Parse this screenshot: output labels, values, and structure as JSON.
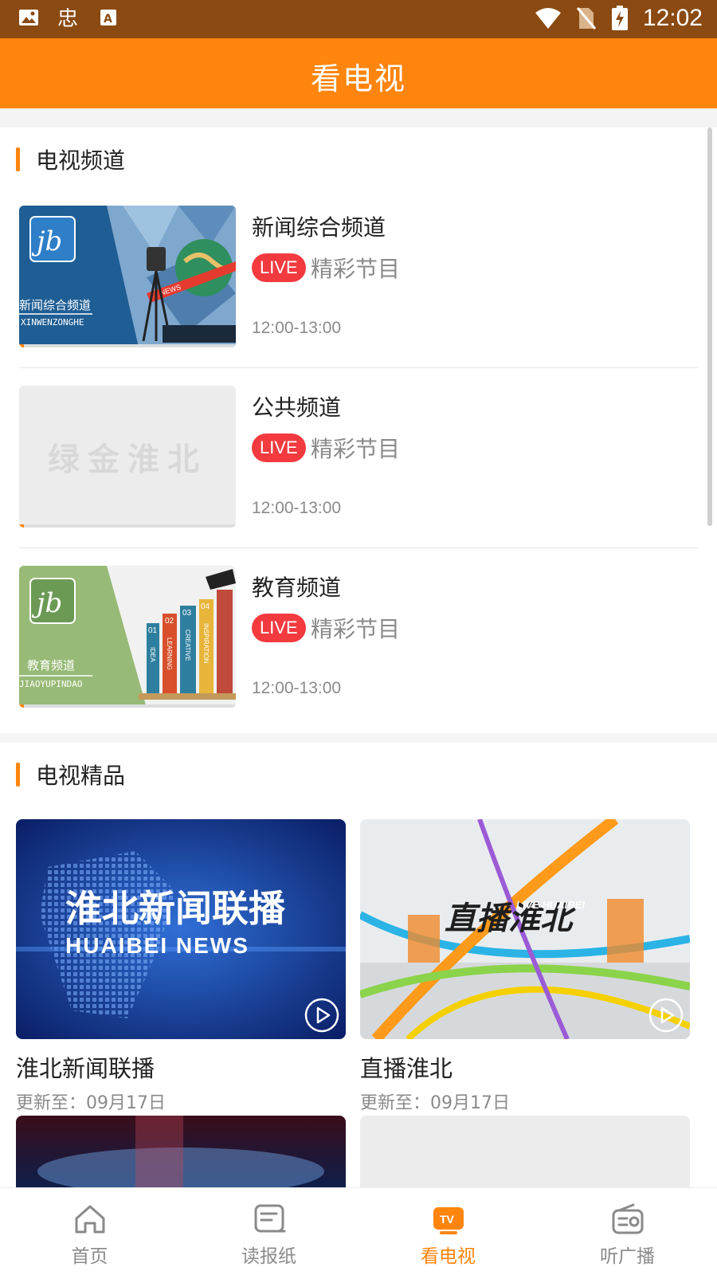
{
  "status_bar": {
    "time": "12:02"
  },
  "app_bar": {
    "title": "看电视"
  },
  "channels_section": {
    "title": "电视频道",
    "items": [
      {
        "name": "新闻综合频道",
        "live_label": "LIVE",
        "program": "精彩节目",
        "time": "12:00-13:00",
        "thumb_text": "新闻综合频道",
        "thumb_pinyin": "XINWENZONGHE",
        "thumb_news": "NEWS"
      },
      {
        "name": "公共频道",
        "live_label": "LIVE",
        "program": "精彩节目",
        "time": "12:00-13:00",
        "thumb_text": "绿金淮北"
      },
      {
        "name": "教育频道",
        "live_label": "LIVE",
        "program": "精彩节目",
        "time": "12:00-13:00",
        "thumb_text": "教育频道",
        "thumb_pinyin": "JIAOYUPINDAO",
        "book_numbers": [
          "01",
          "02",
          "03",
          "04"
        ],
        "book_words": [
          "IDEA",
          "LEARNING",
          "CREATIVE",
          "INSPIRATION"
        ]
      }
    ]
  },
  "featured_section": {
    "title": "电视精品",
    "items": [
      {
        "title": "淮北新闻联播",
        "updated": "更新至：09月17日",
        "img_title": "淮北新闻联播",
        "img_subtitle": "HUAIBEI NEWS"
      },
      {
        "title": "直播淮北",
        "updated": "更新至：09月17日",
        "img_title": "直播淮北",
        "img_subtitle": "LIVE HUAIBEI"
      }
    ]
  },
  "bottom_nav": {
    "items": [
      {
        "label": "首页",
        "icon": "home-icon"
      },
      {
        "label": "读报纸",
        "icon": "newspaper-icon"
      },
      {
        "label": "看电视",
        "icon": "tv-icon",
        "badge": "TV"
      },
      {
        "label": "听广播",
        "icon": "radio-icon"
      }
    ],
    "active_index": 2
  },
  "colors": {
    "accent": "#ff850f",
    "live": "#f23a3f",
    "status_bar": "#8a4a12"
  }
}
